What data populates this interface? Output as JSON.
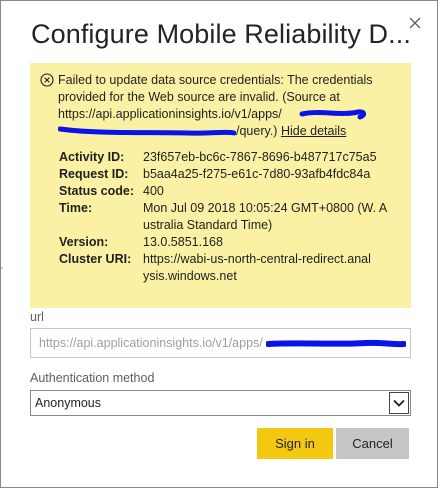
{
  "dialog": {
    "title": "Configure Mobile Reliability D...",
    "close_icon": "close-icon"
  },
  "error": {
    "icon": "error-circle-icon",
    "message_line1": "Failed to update data source credentials: The credentials",
    "message_line2": "provided for the Web source are invalid. (Source at",
    "url_line1": "https://api.applicationinsights.io/v1/apps/",
    "url_line2_end": "/query.)",
    "hide_details": "Hide details",
    "details": [
      {
        "key": "Activity ID:",
        "value": "23f657eb-bc6c-7867-8696-b487717c75a5"
      },
      {
        "key": "Request ID:",
        "value": "b5aa4a25-f275-e61c-7d80-93afb4fdc84a"
      },
      {
        "key": "Status code:",
        "value": "400"
      },
      {
        "key": "Time:",
        "value": "Mon Jul 09 2018 10:05:24 GMT+0800 (W. A ustralia Standard Time)"
      },
      {
        "key": "Version:",
        "value": "13.0.5851.168"
      },
      {
        "key": "Cluster URI:",
        "value": "https://wabi-us-north-central-redirect.anal ysis.windows.net"
      }
    ]
  },
  "url_field": {
    "label": "url",
    "value": "https://api.applicationinsights.io/v1/apps/"
  },
  "auth": {
    "label": "Authentication method",
    "selected": "Anonymous"
  },
  "buttons": {
    "sign_in": "Sign in",
    "cancel": "Cancel"
  },
  "colors": {
    "error_bg": "#fbf1a5",
    "primary": "#f2c811",
    "secondary": "#c8c6c4",
    "redaction": "#0a14e6"
  }
}
